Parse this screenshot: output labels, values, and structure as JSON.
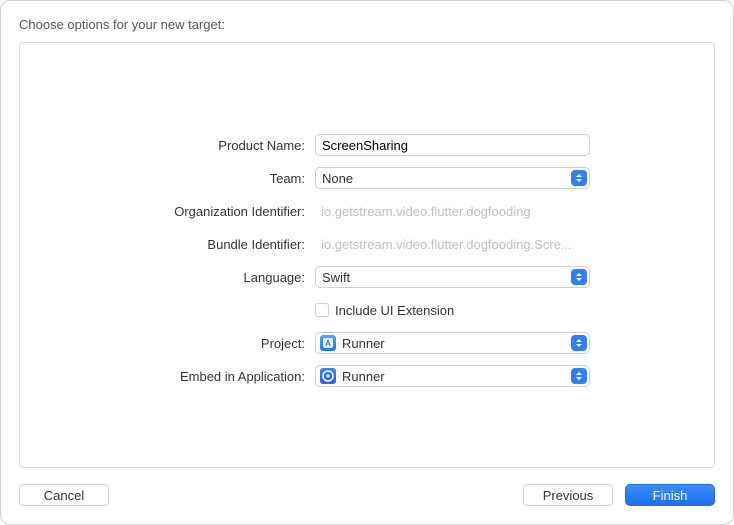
{
  "title": "Choose options for your new target:",
  "form": {
    "productName": {
      "label": "Product Name:",
      "value": "ScreenSharing"
    },
    "team": {
      "label": "Team:",
      "value": "None"
    },
    "orgIdentifier": {
      "label": "Organization Identifier:",
      "value": "io.getstream.video.flutter.dogfooding"
    },
    "bundleIdentifier": {
      "label": "Bundle Identifier:",
      "value": "io.getstream.video.flutter.dogfooding.Scre..."
    },
    "language": {
      "label": "Language:",
      "value": "Swift"
    },
    "includeUIExt": {
      "label": "Include UI Extension",
      "checked": false
    },
    "project": {
      "label": "Project:",
      "value": "Runner"
    },
    "embedInApp": {
      "label": "Embed in Application:",
      "value": "Runner"
    }
  },
  "buttons": {
    "cancel": "Cancel",
    "previous": "Previous",
    "finish": "Finish"
  }
}
